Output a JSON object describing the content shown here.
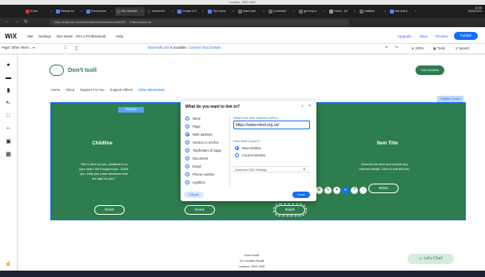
{
  "top_strip": "London, SW1 4AS",
  "browser": {
    "tabs": [
      {
        "label": "S Box",
        "color": "#d93025"
      },
      {
        "label": "Results for",
        "color": "#4a8af4"
      },
      {
        "label": "Environmen",
        "color": "#4a8af4"
      },
      {
        "label": "Wix Website",
        "color": "#555"
      },
      {
        "label": "Jamesh97",
        "color": "#333"
      },
      {
        "label": "Create a Fr",
        "color": "#4a8af4"
      },
      {
        "label": "The Home",
        "color": "#4a8af4"
      },
      {
        "label": "mark rohe",
        "color": "#666"
      },
      {
        "label": "Comfortbl",
        "color": "#666"
      },
      {
        "label": "get help w",
        "color": "#666"
      },
      {
        "label": "Home - Mi",
        "color": "#999"
      },
      {
        "label": "childline",
        "color": "#666"
      },
      {
        "label": "Info and s",
        "color": "#4a8af4"
      }
    ],
    "clock_time": "10:46",
    "clock_date": "24/03/2022",
    "url": "https://editor.wix.com/html/editor/web/renderer/edit/b7b3 ... Editor-session-id"
  },
  "wix": {
    "logo": "WiX",
    "menu": [
      "Site",
      "Settings",
      "Dev Mode",
      "Hire a Professional",
      "Help"
    ],
    "upgrade": "Upgrade",
    "save": "Save",
    "preview": "Preview",
    "publish": "Publish",
    "page_select": "Page: Other Altern...",
    "domain_text": "dont-isolll.com",
    "domain_suffix": " is available.",
    "domain_link": "Connect Your Domain",
    "zoom": "100%",
    "tools": "Tools",
    "search": "Search"
  },
  "site": {
    "name": "Don't Isoll",
    "get_involved": "Get Involved",
    "nav": [
      "Home",
      "About",
      "Support For You",
      "Support Others"
    ],
    "nav_more": "Other alternatives",
    "section_tag": "Section: Footer",
    "repeater_tag": "Repeater",
    "columns": [
      {
        "title": "Childline",
        "text": "\"We're here for you, whatever's on your mind. We'll support you. Guide you. Help you make decisions that are right for you.\"",
        "visit": "Visit"
      },
      {
        "title": "",
        "text": "",
        "visit": "Visit"
      },
      {
        "title": "",
        "text": "",
        "visit": "Visit"
      },
      {
        "title": "Item Title",
        "text": "Describe the item and include any relevant details. Click to edit the text.",
        "visit": "Visit"
      }
    ],
    "address": [
      "Don't Isolll",
      "24 Comfort Road",
      "London, SW1 4AS"
    ],
    "chat": "Let's Chat!"
  },
  "dialog": {
    "title": "What do you want to link to?",
    "options": [
      "None",
      "Page",
      "Web address",
      "Section or anchor",
      "Top/bottom of page",
      "Document",
      "Email",
      "Phone number",
      "Lightbox"
    ],
    "selected": "Web address",
    "address_label": "What's the web address (URL)?",
    "address_value": "https://www.mind.org.uk/",
    "open_label": "How does it open?",
    "open_options": [
      "New window",
      "Current window"
    ],
    "open_selected": "New window",
    "advanced": "Advanced SEO Settings",
    "cancel": "Cancel",
    "done": "Done"
  }
}
